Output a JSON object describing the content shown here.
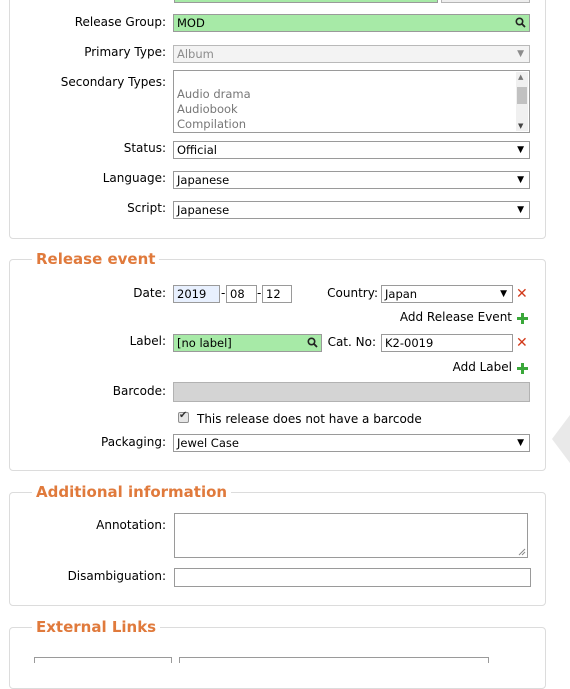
{
  "release_info": {
    "release_group_label": "Release Group:",
    "release_group_value": "MOD",
    "primary_type_label": "Primary Type:",
    "primary_type_value": "Album",
    "secondary_types_label": "Secondary Types:",
    "secondary_types_options": [
      "Audio drama",
      "Audiobook",
      "Compilation"
    ],
    "status_label": "Status:",
    "status_value": "Official",
    "language_label": "Language:",
    "language_value": "Japanese",
    "script_label": "Script:",
    "script_value": "Japanese"
  },
  "release_event": {
    "legend": "Release event",
    "date_label": "Date:",
    "date_year": "2019",
    "date_month": "08",
    "date_day": "12",
    "date_sep": "-",
    "country_label": "Country:",
    "country_value": "Japan",
    "add_release_event": "Add Release Event",
    "label_label": "Label:",
    "label_value": "[no label]",
    "catno_label": "Cat. No:",
    "catno_value": "K2-0019",
    "add_label": "Add Label",
    "barcode_label": "Barcode:",
    "barcode_value": "",
    "no_barcode_text": "This release does not have a barcode",
    "no_barcode_checked": true,
    "packaging_label": "Packaging:",
    "packaging_value": "Jewel Case"
  },
  "additional_information": {
    "legend": "Additional information",
    "annotation_label": "Annotation:",
    "annotation_value": "",
    "disambiguation_label": "Disambiguation:",
    "disambiguation_value": ""
  },
  "external_links": {
    "legend": "External Links"
  },
  "colors": {
    "legend": "#e07a3c",
    "autocomplete_green": "#a7eaa7",
    "remove_red": "#d23a1a",
    "add_green": "#3aa83a"
  }
}
